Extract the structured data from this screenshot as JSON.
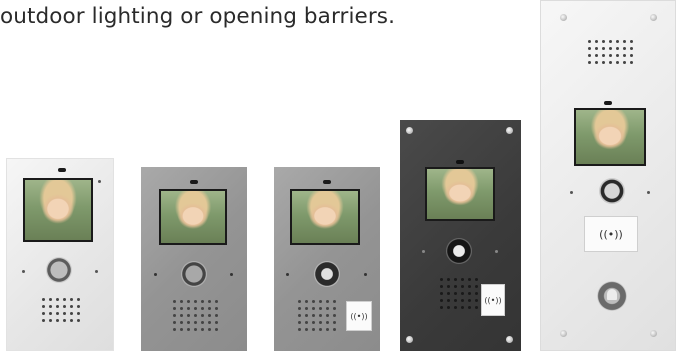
{
  "caption": "outdoor lighting or opening barriers.",
  "rfid_symbol": "((•))",
  "colors": {
    "white_panel": "#e9e9e9",
    "silver_panel": "#969696",
    "dark_panel": "#3c3c3c"
  }
}
